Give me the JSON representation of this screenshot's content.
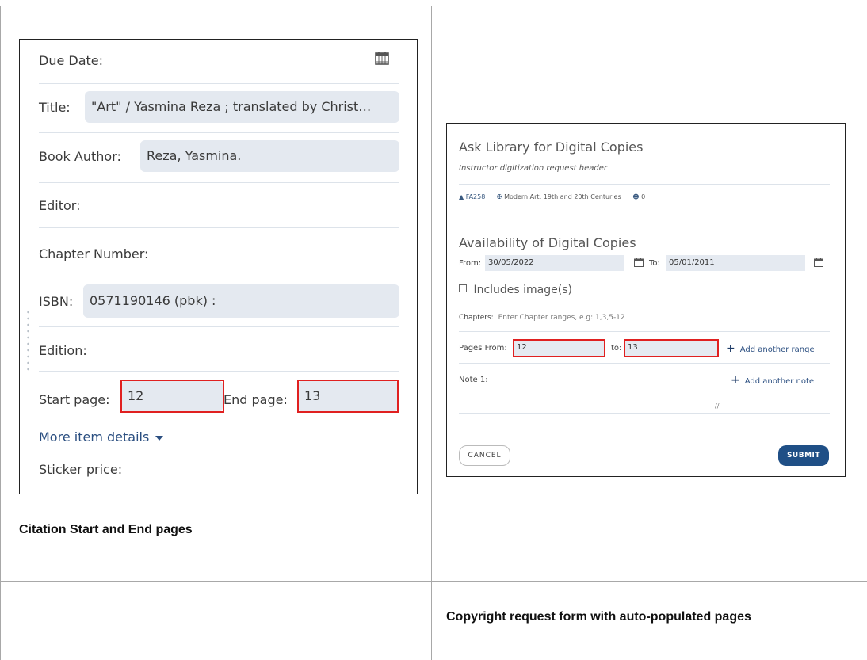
{
  "citation_panel": {
    "due_date_label": "Due Date:",
    "title_label": "Title:",
    "title_value": "\"Art\" / Yasmina Reza ; translated by Christ…",
    "author_label": "Book Author:",
    "author_value": "Reza, Yasmina.",
    "editor_label": "Editor:",
    "chapter_label": "Chapter Number:",
    "isbn_label": "ISBN:",
    "isbn_value": "0571190146 (pbk) :",
    "edition_label": "Edition:",
    "start_page_label": "Start page:",
    "start_page_value": "12",
    "end_page_label": "End page:",
    "end_page_value": "13",
    "more_details": "More item details",
    "sticker_price_label": "Sticker price:"
  },
  "captions": {
    "left": "Citation Start and End pages",
    "right": "Copyright request form with auto-populated pages"
  },
  "request_form": {
    "title": "Ask Library for Digital Copies",
    "subtitle": "Instructor digitization request header",
    "course_code": "FA258",
    "course_name": "Modern Art: 19th and 20th Centuries",
    "participants": "0",
    "availability_title": "Availability of Digital Copies",
    "from_label": "From:",
    "from_value": "30/05/2022",
    "to_label": "To:",
    "to_value": "05/01/2011",
    "includes_images": "Includes image(s)",
    "chapters_label": "Chapters:",
    "chapters_placeholder": "Enter Chapter ranges, e.g: 1,3,5-12",
    "pages_from_label": "Pages From:",
    "pages_from_value": "12",
    "pages_to_label": "to:",
    "pages_to_value": "13",
    "add_range": "Add another range",
    "note_label": "Note 1:",
    "add_note": "Add another note",
    "cancel": "CANCEL",
    "submit": "SUBMIT"
  },
  "colors": {
    "highlight_red": "#e02020",
    "submit_blue": "#1f4f86",
    "link_blue": "#2a4e80",
    "field_bg": "#e4e9f0"
  }
}
